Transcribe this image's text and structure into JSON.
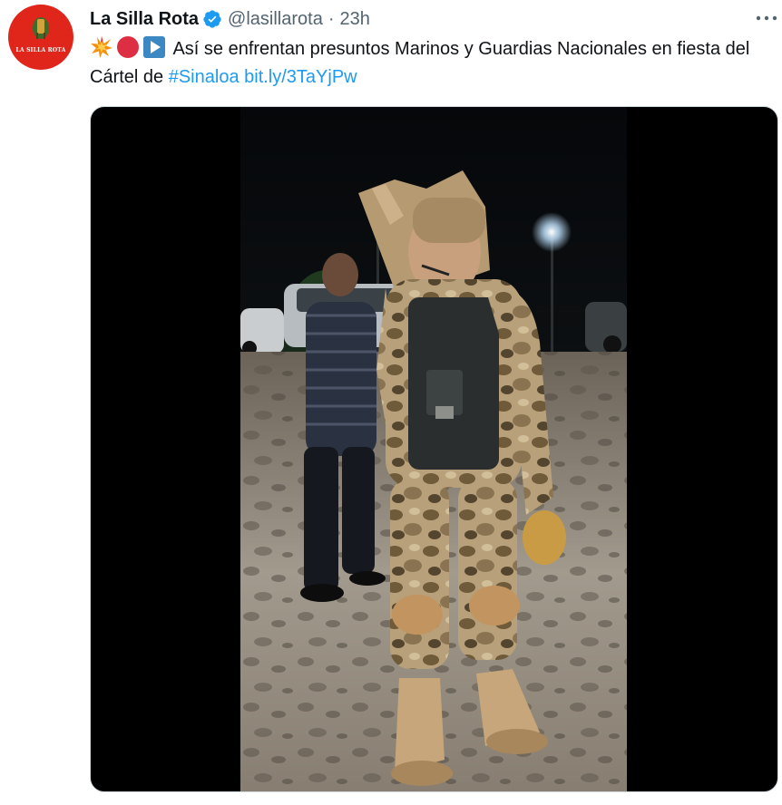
{
  "author": {
    "name": "La Silla Rota",
    "handle": "@lasillarota",
    "separator": "·",
    "time": "23h",
    "avatar_text": "LA SILLA ROTA",
    "verified": true
  },
  "tweet": {
    "text_main": "Así se enfrentan presuntos Marinos y Guardias Nacionales en fiesta del Cártel de ",
    "hashtag": "#Sinaloa",
    "url": "bit.ly/3TaYjPw",
    "emojis": [
      "collision-emoji",
      "red-circle-emoji",
      "play-button-emoji"
    ]
  },
  "colors": {
    "avatar_bg": "#e0251b",
    "link": "#1d9bf0",
    "verified": "#1d9bf0",
    "muted": "#536471",
    "media_bg": "#000000"
  },
  "icons": {
    "more": "more-options-icon",
    "verified": "verified-badge-icon"
  }
}
